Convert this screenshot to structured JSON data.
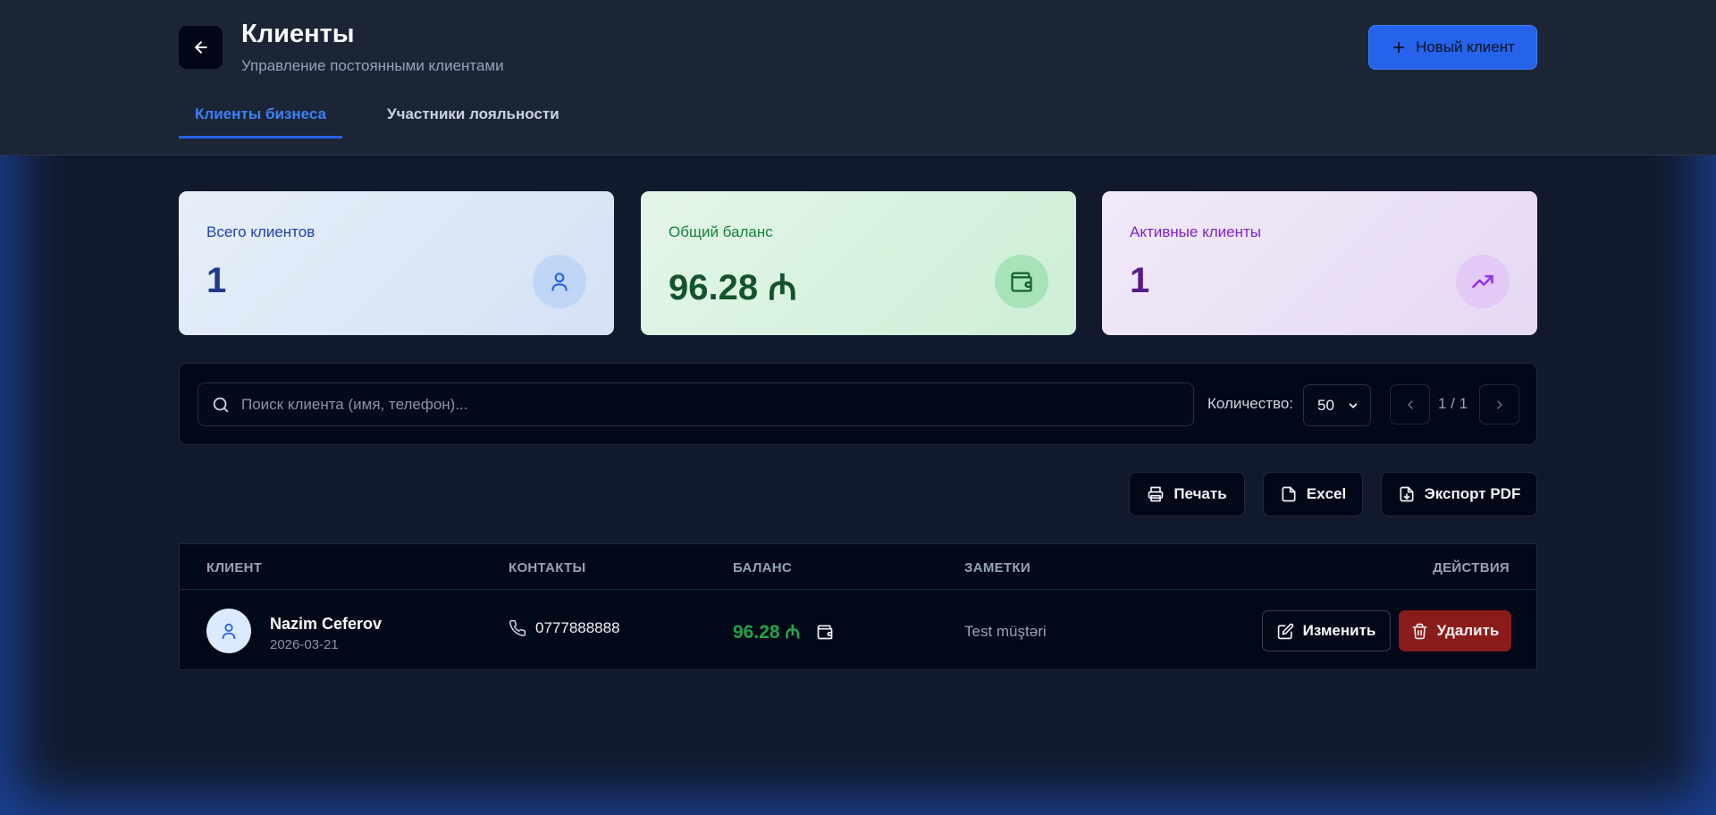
{
  "header": {
    "title": "Клиенты",
    "subtitle": "Управление постоянными клиентами",
    "new_client_label": "Новый клиент"
  },
  "tabs": [
    {
      "label": "Клиенты бизнеса",
      "active": true
    },
    {
      "label": "Участники лояльности",
      "active": false
    }
  ],
  "stats": [
    {
      "label": "Всего клиентов",
      "value": "1",
      "icon": "user-icon",
      "color": "#1e3a8a"
    },
    {
      "label": "Общий баланс",
      "value": "96.28 ₼",
      "icon": "wallet-icon",
      "color": "#14532d"
    },
    {
      "label": "Активные клиенты",
      "value": "1",
      "icon": "trending-up-icon",
      "color": "#581c87"
    }
  ],
  "filters": {
    "search_placeholder": "Поиск клиента (имя, телефон)...",
    "search_value": "",
    "quantity_label": "Количество:",
    "quantity_value": "50",
    "pagination": "1 / 1"
  },
  "actions": {
    "print": "Печать",
    "excel": "Excel",
    "pdf": "Экспорт PDF"
  },
  "table": {
    "columns": [
      "КЛИЕНТ",
      "КОНТАКТЫ",
      "БАЛАНС",
      "ЗАМЕТКИ",
      "ДЕЙСТВИЯ"
    ],
    "rows": [
      {
        "name": "Nazim Ceferov",
        "date": "2026-03-21",
        "phone": "0777888888",
        "balance": "96.28 ₼",
        "note": "Test müştəri",
        "edit_label": "Изменить",
        "delete_label": "Удалить"
      }
    ]
  },
  "colors": {
    "accent": "#2563eb",
    "danger": "#8b1c1c",
    "balance": "#22a34a"
  }
}
